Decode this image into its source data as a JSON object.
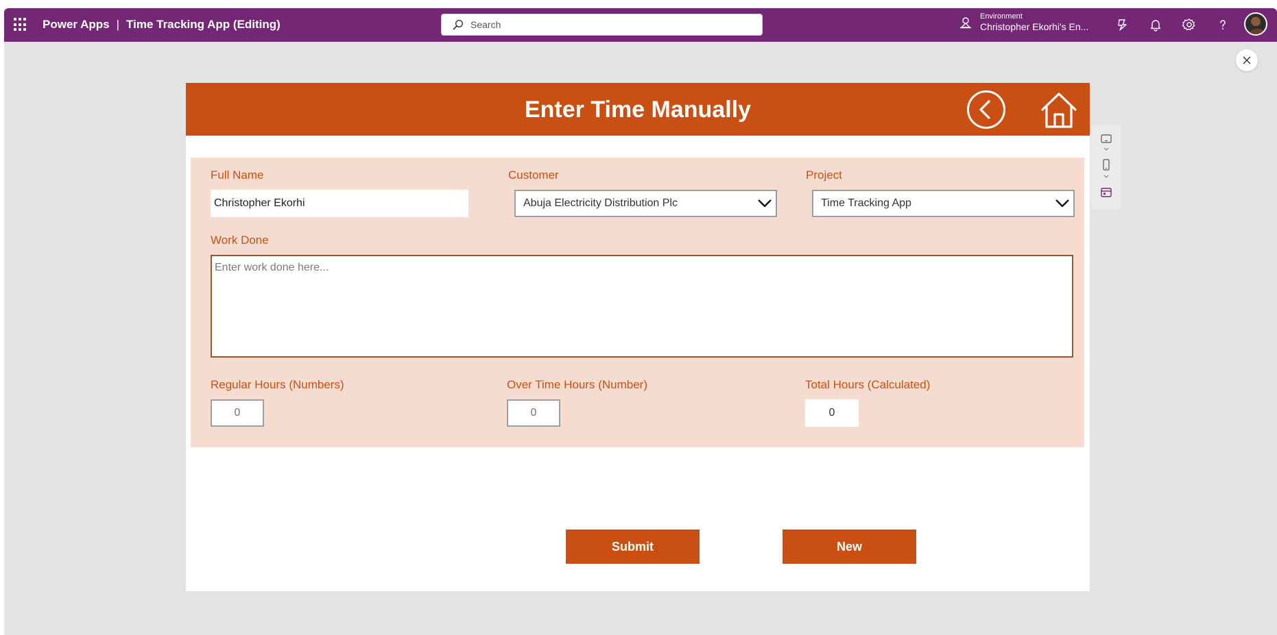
{
  "header": {
    "app_name": "Power Apps",
    "separator": "|",
    "app_title": "Time Tracking App (Editing)",
    "search_placeholder": "Search",
    "environment_label": "Environment",
    "environment_name": "Christopher Ekorhi's En...",
    "icons": [
      "waffle-icon",
      "search-icon",
      "environment-icon",
      "copilot-icon",
      "bell-icon",
      "gear-icon",
      "help-icon",
      "avatar"
    ]
  },
  "app": {
    "title": "Enter Time Manually",
    "fields": {
      "full_name_label": "Full Name",
      "full_name_value": "Christopher Ekorhi",
      "customer_label": "Customer",
      "customer_value": "Abuja Electricity Distribution Plc",
      "project_label": "Project",
      "project_value": "Time Tracking App",
      "work_done_label": "Work Done",
      "work_done_placeholder": "Enter work done here...",
      "regular_hours_label": "Regular Hours (Numbers)",
      "regular_hours_placeholder": "0",
      "overtime_hours_label": "Over Time Hours (Number)",
      "overtime_hours_placeholder": "0",
      "total_hours_label": "Total Hours (Calculated)",
      "total_hours_value": "0"
    },
    "buttons": {
      "submit": "Submit",
      "new": "New"
    }
  },
  "colors": {
    "header_purple": "#742774",
    "accent_orange": "#c94f13",
    "form_panel": "#f5dcd1"
  }
}
